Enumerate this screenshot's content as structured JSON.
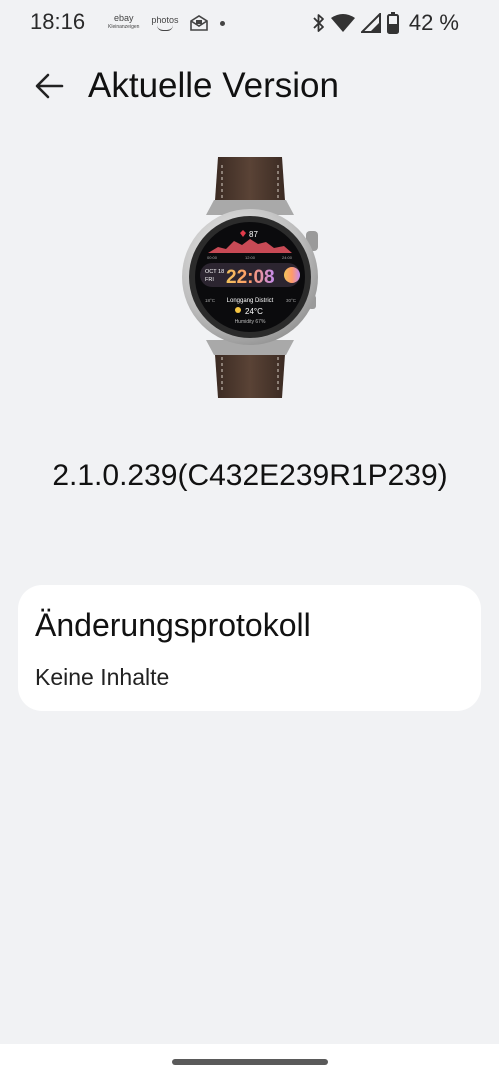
{
  "status_bar": {
    "time": "18:16",
    "notifications": {
      "ebay_label": "ebay",
      "ebay_sub": "Kleinanzeigen",
      "photos_label": "photos"
    },
    "battery_percent": "42 %"
  },
  "header": {
    "title": "Aktuelle Version"
  },
  "device": {
    "watch_screen": {
      "heart_rate": "87",
      "date_month_day": "OCT 18",
      "date_weekday": "FRI",
      "clock": "22:08",
      "location": "Longgang District",
      "temperature": "24°C",
      "humidity": "Humidity 67%",
      "low_temp": "18°C",
      "high_temp": "30°C",
      "tick_left": "00:00",
      "tick_mid": "12:00",
      "tick_right": "24:00"
    }
  },
  "version": {
    "number": "2.1.0.239(C432E239R1P239)"
  },
  "changelog": {
    "title": "Änderungsprotokoll",
    "body": "Keine Inhalte"
  },
  "colors": {
    "background": "#f1f2f4",
    "card": "#ffffff",
    "strap": "#4a372d",
    "clock_gradient_start": "#f2c35b",
    "clock_gradient_end": "#c58cf0"
  }
}
